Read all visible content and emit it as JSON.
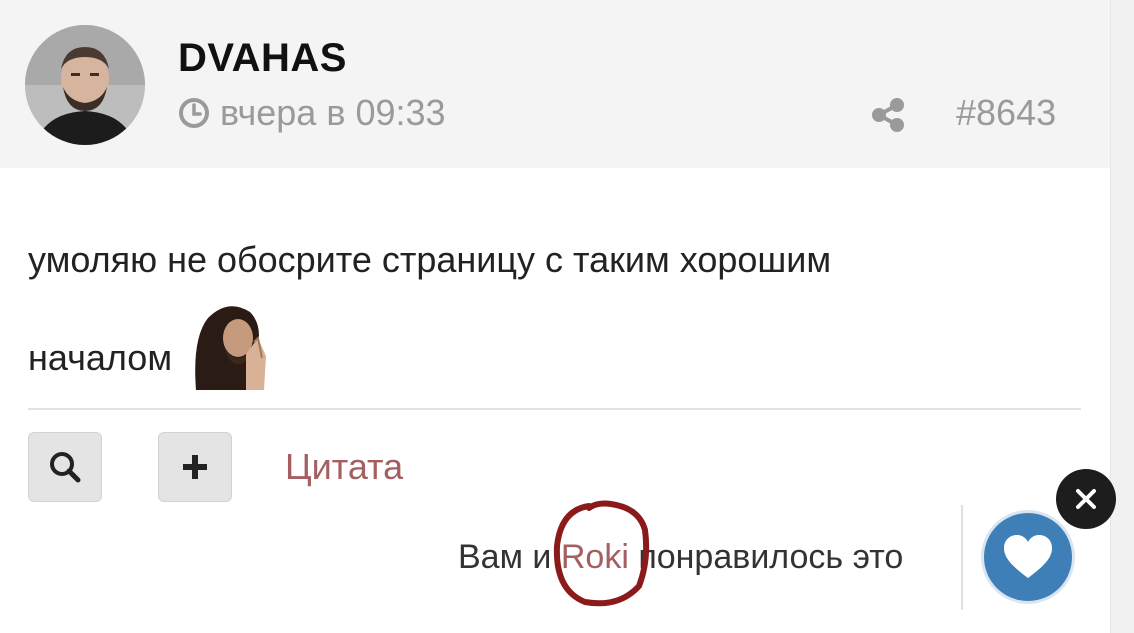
{
  "post": {
    "author": "DVAHAS",
    "timestamp": "вчера в 09:33",
    "number": "#8643",
    "body_line1": "умоляю не обосрите страницу с таким хорошим",
    "body_line2": "началом"
  },
  "actions": {
    "quote_label": "Цитата"
  },
  "likes": {
    "prefix": "Вам и ",
    "liker": "Roki",
    "suffix": " понравилось это"
  },
  "icons": {
    "clock": "clock-icon",
    "share": "share-icon",
    "search": "search-icon",
    "plus": "plus-icon",
    "heart": "heart-icon",
    "close": "close-icon"
  },
  "colors": {
    "link": "#a46060",
    "header_bg": "#f4f4f4",
    "heart_button": "#3f7fb8",
    "annotation": "#8b1a1a"
  }
}
